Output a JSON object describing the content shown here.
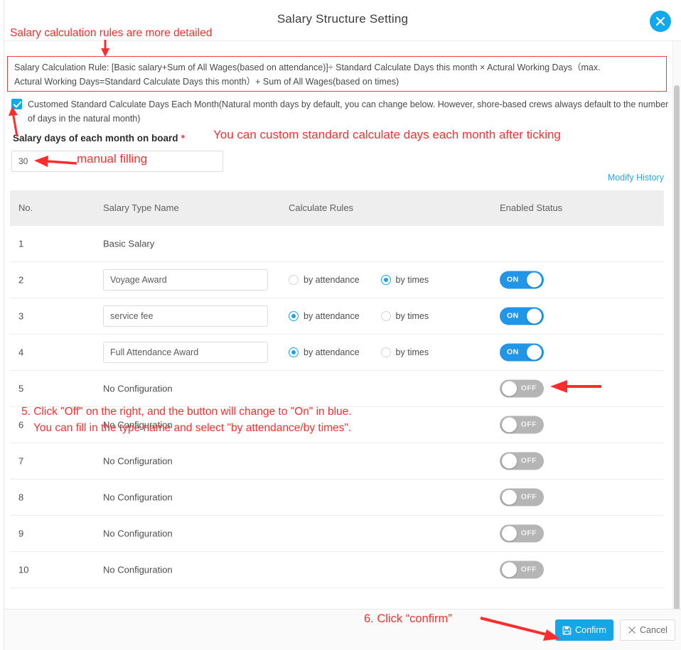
{
  "dialog": {
    "title": "Salary Structure Setting",
    "close_icon": "close-icon"
  },
  "rule_box": {
    "line1": "Salary Calculation Rule: [Basic salary+Sum of All Wages(based on attendance)]÷ Standard Calculate Days this month × Actural Working Days（max.",
    "line2": "Actural Working Days=Standard Calculate Days this month）+ Sum of All Wages(based on times)"
  },
  "custom_days": {
    "checkbox_checked": true,
    "checkbox_label": "Customed Standard Calculate Days Each Month(Natural month days by default, you can change below. However, shore-based crews always default to the number of days in the natural month)",
    "field_label": "Salary days of each month on board",
    "required_mark": "*",
    "input_value": "30",
    "input_placeholder": "30"
  },
  "modify_history": {
    "label": "Modify History"
  },
  "table": {
    "headers": [
      "No.",
      "Salary Type Name",
      "Calculate Rules",
      "Enabled Status"
    ],
    "radio_labels": {
      "by_attendance": "by attendance",
      "by_times": "by times"
    },
    "toggle_on_label": "ON",
    "toggle_off_label": "OFF",
    "no_configuration_text": "No Configuration",
    "rows": [
      {
        "no": "1",
        "name": "Basic Salary",
        "name_is_input": false,
        "has_rules": false,
        "has_toggle": false,
        "rule": "",
        "toggle": ""
      },
      {
        "no": "2",
        "name": "Voyage Award",
        "name_is_input": true,
        "has_rules": true,
        "has_toggle": true,
        "rule": "by_times",
        "toggle": "on"
      },
      {
        "no": "3",
        "name": "service fee",
        "name_is_input": true,
        "has_rules": true,
        "has_toggle": true,
        "rule": "by_attendance",
        "toggle": "on"
      },
      {
        "no": "4",
        "name": "Full Attendance Award",
        "name_is_input": true,
        "has_rules": true,
        "has_toggle": true,
        "rule": "by_attendance",
        "toggle": "on"
      },
      {
        "no": "5",
        "name": "No Configuration",
        "name_is_input": false,
        "has_rules": false,
        "has_toggle": true,
        "rule": "",
        "toggle": "off"
      },
      {
        "no": "6",
        "name": "No Configuration",
        "name_is_input": false,
        "has_rules": false,
        "has_toggle": true,
        "rule": "",
        "toggle": "off"
      },
      {
        "no": "7",
        "name": "No Configuration",
        "name_is_input": false,
        "has_rules": false,
        "has_toggle": true,
        "rule": "",
        "toggle": "off"
      },
      {
        "no": "8",
        "name": "No Configuration",
        "name_is_input": false,
        "has_rules": false,
        "has_toggle": true,
        "rule": "",
        "toggle": "off"
      },
      {
        "no": "9",
        "name": "No Configuration",
        "name_is_input": false,
        "has_rules": false,
        "has_toggle": true,
        "rule": "",
        "toggle": "off"
      },
      {
        "no": "10",
        "name": "No Configuration",
        "name_is_input": false,
        "has_rules": false,
        "has_toggle": true,
        "rule": "",
        "toggle": "off"
      }
    ]
  },
  "footer": {
    "confirm_label": "Confirm",
    "cancel_label": "Cancel",
    "confirm_icon": "save-icon",
    "cancel_icon": "close-x-icon"
  },
  "annotations": {
    "a1": "Salary calculation rules are more detailed",
    "a2": "You can custom standard calculate days each month after ticking",
    "a3": "manual filling",
    "a4_line1": "5. Click \"Off\" on the right, and the button will change to \"On\" in blue.",
    "a4_line2": "    You can fill in the type name and select \"by attendance/by times\".",
    "a5": "6. Click “confirm”",
    "color": "#fe2d2d"
  }
}
